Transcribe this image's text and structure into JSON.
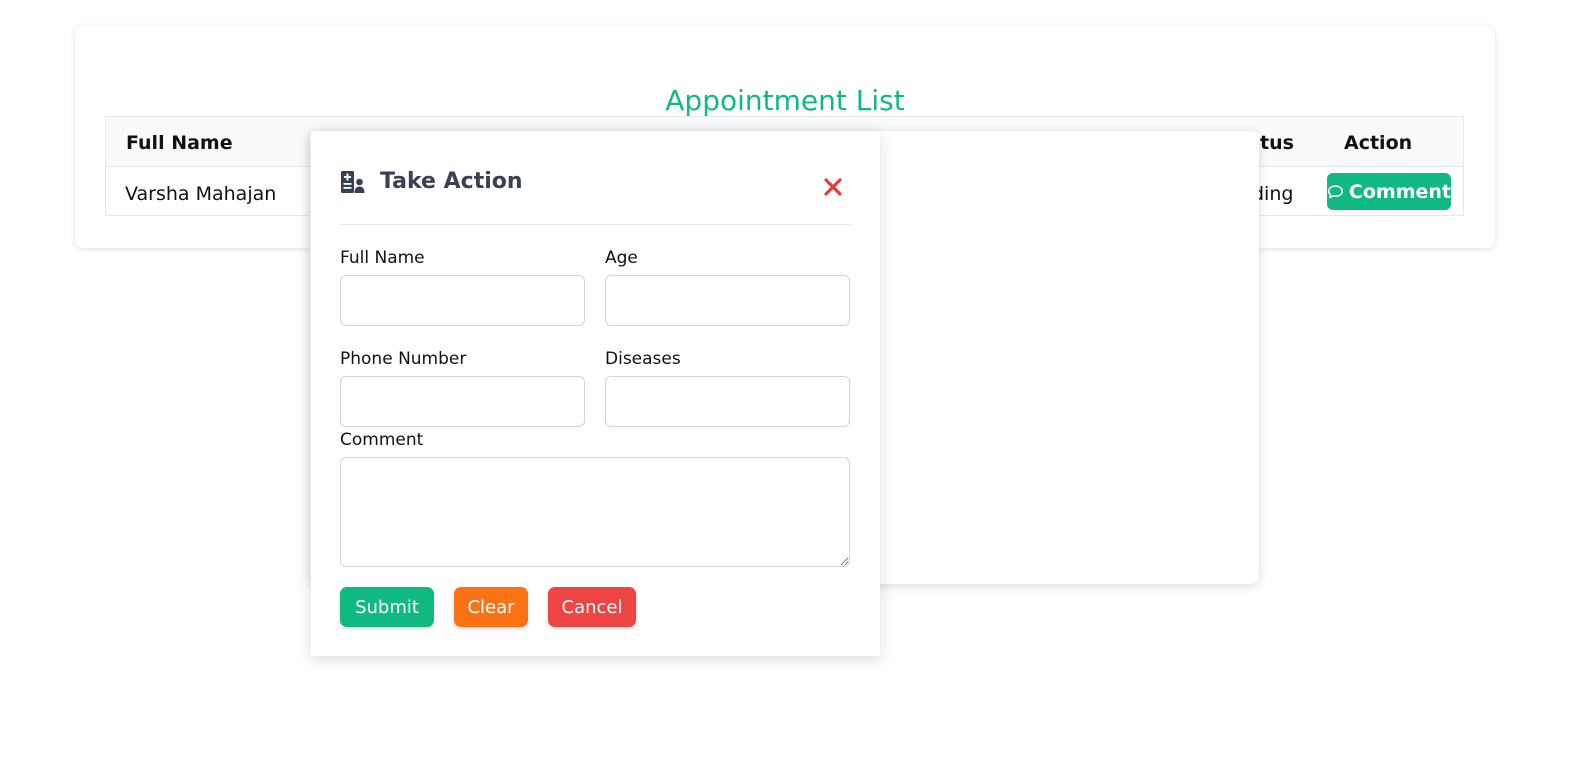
{
  "page": {
    "title": "Appointment List"
  },
  "table": {
    "headers": {
      "full_name": "Full Name",
      "status_partial": "tus",
      "action": "Action"
    },
    "rows": [
      {
        "full_name": "Varsha Mahajan",
        "status_partial": "ding",
        "action_label": "Comment"
      }
    ]
  },
  "modal": {
    "title": "Take Action",
    "fields": {
      "full_name": {
        "label": "Full Name",
        "value": ""
      },
      "age": {
        "label": "Age",
        "value": ""
      },
      "phone": {
        "label": "Phone Number",
        "value": ""
      },
      "diseases": {
        "label": "Diseases",
        "value": ""
      },
      "comment": {
        "label": "Comment",
        "value": ""
      }
    },
    "buttons": {
      "submit": "Submit",
      "clear": "Clear",
      "cancel": "Cancel"
    }
  },
  "colors": {
    "accent_green": "#10b981",
    "orange": "#f97316",
    "red": "#ef4444",
    "close_red": "#e53e3e"
  },
  "icons": {
    "modal_header": "medical-record-icon",
    "close": "close-icon",
    "comment": "chat-bubble-icon"
  }
}
